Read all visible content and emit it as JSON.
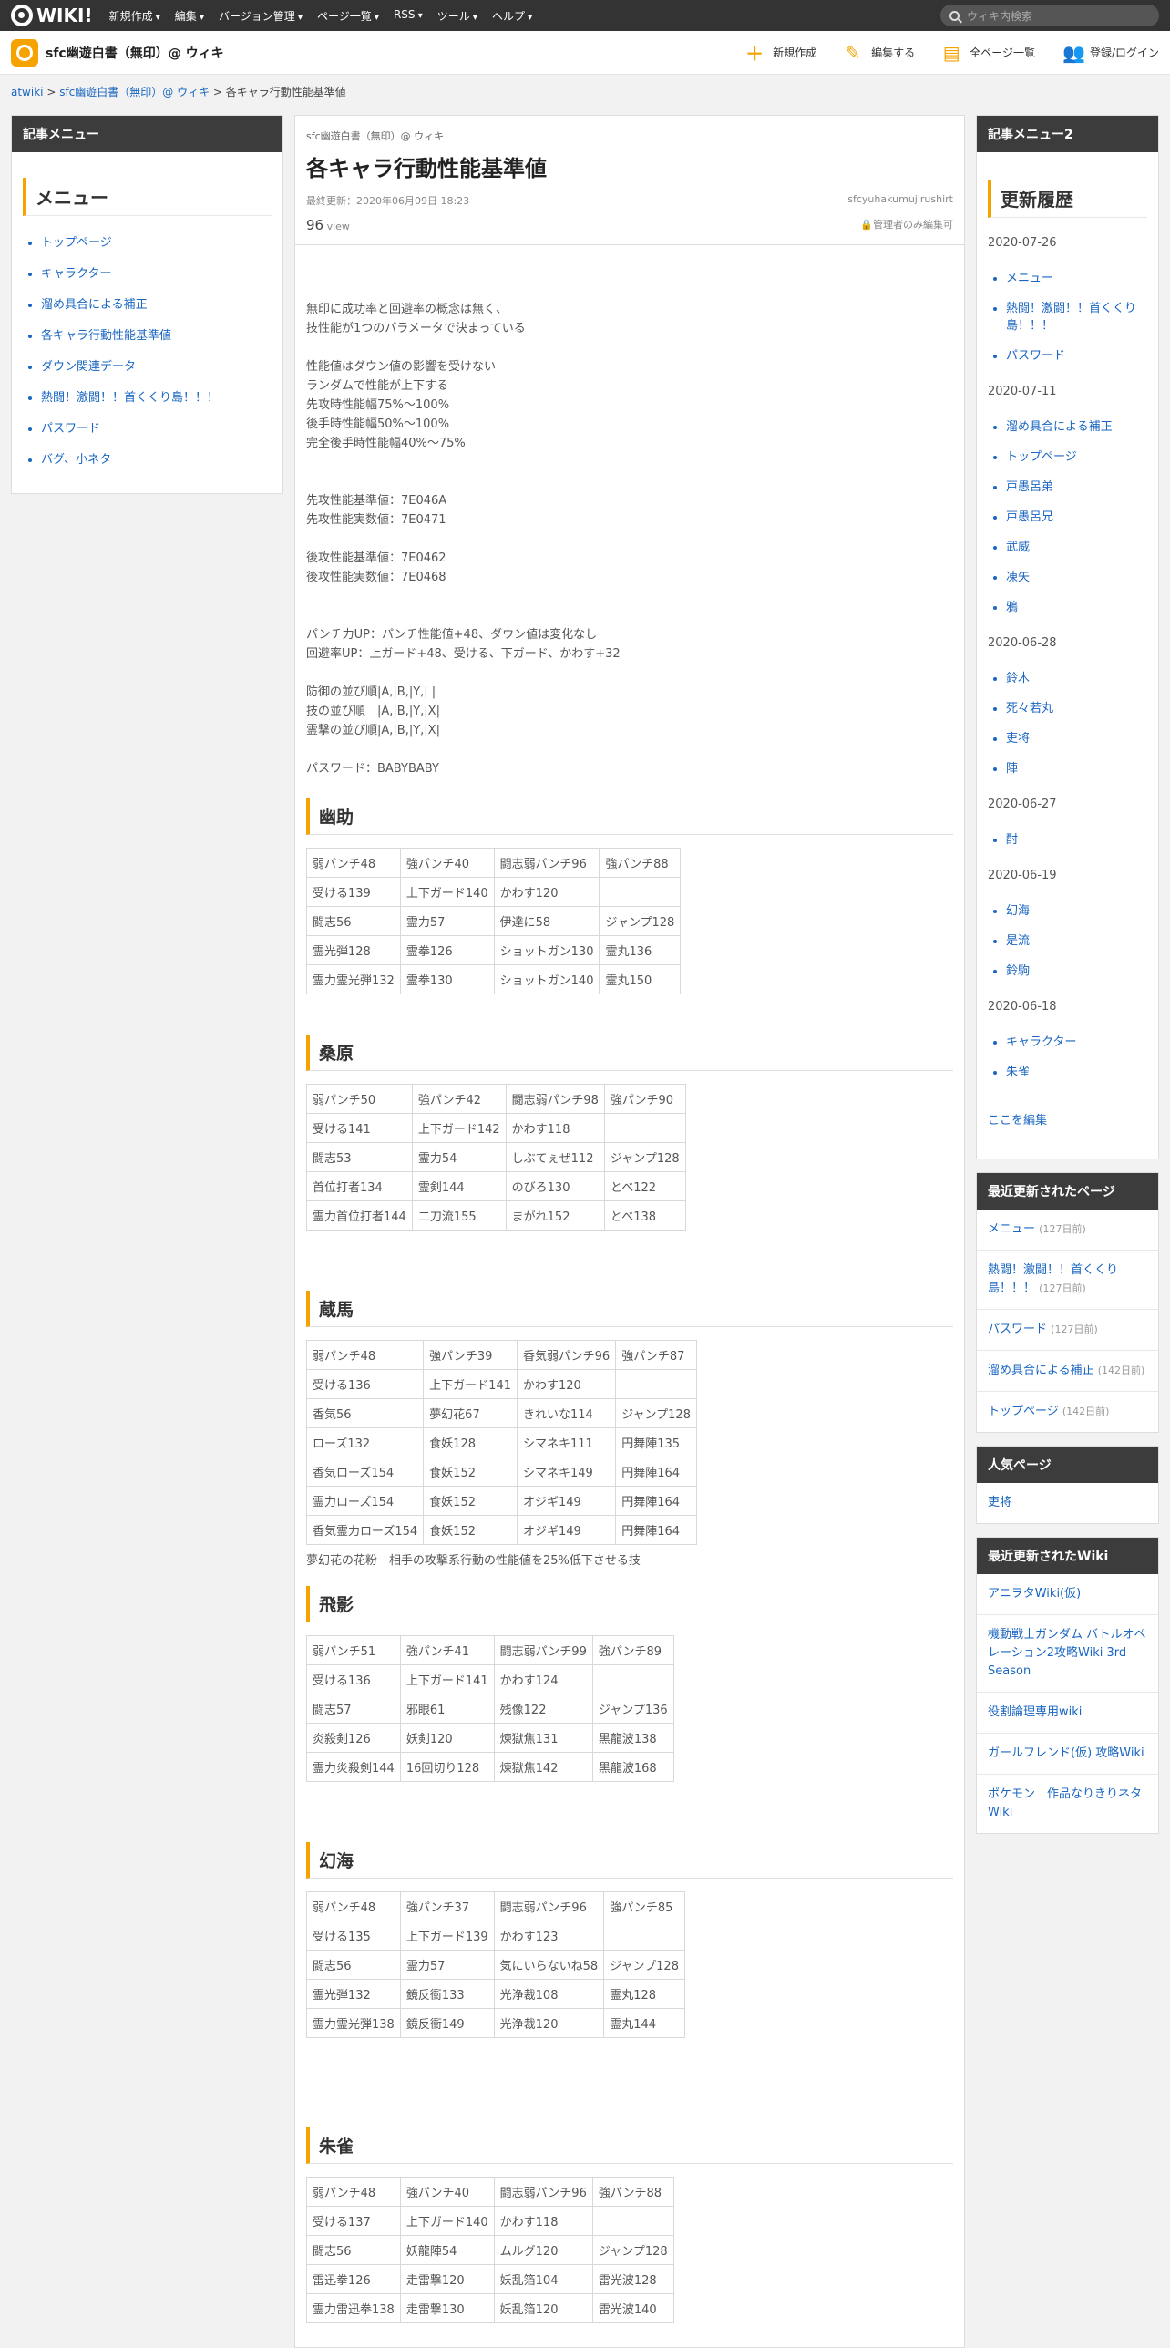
{
  "global": {
    "logo": "WIKI!",
    "menu": [
      "新規作成",
      "編集",
      "バージョン管理",
      "ページ一覧",
      "RSS",
      "ツール",
      "ヘルプ"
    ],
    "search_placeholder": "ウィキ内検索"
  },
  "header": {
    "wiki_name": "sfc幽遊白書（無印）@ ウィキ",
    "actions": [
      "新規作成",
      "編集する",
      "全ページ一覧",
      "登録/ログイン"
    ]
  },
  "breadcrumb": [
    "atwiki",
    "sfc幽遊白書（無印）@ ウィキ",
    "各キャラ行動性能基準値"
  ],
  "left": {
    "box_title": "記事メニュー",
    "menu_heading": "メニュー",
    "items": [
      "トップページ",
      "キャラクター",
      "溜め具合による補正",
      "各キャラ行動性能基準値",
      "ダウン関連データ",
      "熱闘！激闘！！首くくり島！！！",
      "パスワード",
      "バグ、小ネタ"
    ]
  },
  "article": {
    "site": "sfc幽遊白書（無印）@ ウィキ",
    "title": "各キャラ行動性能基準値",
    "updated": "最終更新：2020年06月09日 18:23",
    "author": "sfcyuhakumujirushirt",
    "views_num": "96",
    "views_label": "view",
    "lock": "管理者のみ編集可",
    "paragraphs": [
      "無印に成功率と回避率の概念は無く、\n技性能が1つのパラメータで決まっている",
      "性能値はダウン値の影響を受けない\nランダムで性能が上下する\n先攻時性能幅75%～100%\n後手時性能幅50%～100%\n完全後手時性能幅40%～75%",
      "先攻性能基準値：7E046A\n先攻性能実数値：7E0471",
      "後攻性能基準値：7E0462\n後攻性能実数値：7E0468",
      "パンチ力UP：パンチ性能値+48、ダウン値は変化なし\n回避率UP：上ガード+48、受ける、下ガード、かわす+32",
      "防御の並び順|A,|B,|Y,| |\n技の並び順　|A,|B,|Y,|X|\n霊撃の並び順|A,|B,|Y,|X|",
      "パスワード：BABYBABY"
    ],
    "sections": [
      {
        "name": "幽助",
        "rows": [
          [
            "弱パンチ48",
            "強パンチ40",
            "闘志弱パンチ96",
            "強パンチ88"
          ],
          [
            "受ける139",
            "上下ガード140",
            "かわす120",
            ""
          ],
          [
            "闘志56",
            "霊力57",
            "伊達に58",
            "ジャンプ128"
          ],
          [
            "霊光弾128",
            "霊拳126",
            "ショットガン130",
            "霊丸136"
          ],
          [
            "霊力霊光弾132",
            "霊拳130",
            "ショットガン140",
            "霊丸150"
          ]
        ],
        "note": ""
      },
      {
        "name": "桑原",
        "rows": [
          [
            "弱パンチ50",
            "強パンチ42",
            "闘志弱パンチ98",
            "強パンチ90"
          ],
          [
            "受ける141",
            "上下ガード142",
            "かわす118",
            ""
          ],
          [
            "闘志53",
            "霊力54",
            "しぶてぇぜ112",
            "ジャンプ128"
          ],
          [
            "首位打者134",
            "霊剣144",
            "のびろ130",
            "とべ122"
          ],
          [
            "霊力首位打者144",
            "二刀流155",
            "まがれ152",
            "とべ138"
          ]
        ],
        "note": ""
      },
      {
        "name": "蔵馬",
        "rows": [
          [
            "弱パンチ48",
            "強パンチ39",
            "香気弱パンチ96",
            "強パンチ87"
          ],
          [
            "受ける136",
            "上下ガード141",
            "かわす120",
            ""
          ],
          [
            "香気56",
            "夢幻花67",
            "きれいな114",
            "ジャンプ128"
          ],
          [
            "ローズ132",
            "食妖128",
            "シマネキ111",
            "円舞陣135"
          ],
          [
            "香気ローズ154",
            "食妖152",
            "シマネキ149",
            "円舞陣164"
          ],
          [
            "霊力ローズ154",
            "食妖152",
            "オジギ149",
            "円舞陣164"
          ],
          [
            "香気霊力ローズ154",
            "食妖152",
            "オジギ149",
            "円舞陣164"
          ]
        ],
        "note": "夢幻花の花粉　相手の攻撃系行動の性能値を25%低下させる技"
      },
      {
        "name": "飛影",
        "rows": [
          [
            "弱パンチ51",
            "強パンチ41",
            "闘志弱パンチ99",
            "強パンチ89"
          ],
          [
            "受ける136",
            "上下ガード141",
            "かわす124",
            ""
          ],
          [
            "闘志57",
            "邪眼61",
            "残像122",
            "ジャンプ136"
          ],
          [
            "炎殺剣126",
            "妖剣120",
            "煉獄焦131",
            "黒龍波138"
          ],
          [
            "霊力炎殺剣144",
            "16回切り128",
            "煉獄焦142",
            "黒龍波168"
          ]
        ],
        "note": ""
      },
      {
        "name": "幻海",
        "rows": [
          [
            "弱パンチ48",
            "強パンチ37",
            "闘志弱パンチ96",
            "強パンチ85"
          ],
          [
            "受ける135",
            "上下ガード139",
            "かわす123",
            ""
          ],
          [
            "闘志56",
            "霊力57",
            "気にいらないね58",
            "ジャンプ128"
          ],
          [
            "霊光弾132",
            "鏡反衝133",
            "光浄裁108",
            "霊丸128"
          ],
          [
            "霊力霊光弾138",
            "鏡反衝149",
            "光浄裁120",
            "霊丸144"
          ]
        ],
        "note": ""
      },
      {
        "name": "朱雀",
        "rows": [
          [
            "弱パンチ48",
            "強パンチ40",
            "闘志弱パンチ96",
            "強パンチ88"
          ],
          [
            "受ける137",
            "上下ガード140",
            "かわす118",
            ""
          ],
          [
            "闘志56",
            "妖龍陣54",
            "ムルグ120",
            "ジャンプ128"
          ],
          [
            "雷迅拳126",
            "走雷撃120",
            "妖乱箔104",
            "雷光波128"
          ],
          [
            "霊力雷迅拳138",
            "走雷撃130",
            "妖乱箔120",
            "雷光波140"
          ]
        ],
        "note": ""
      }
    ]
  },
  "right": {
    "box_title": "記事メニュー2",
    "heading": "更新履歴",
    "history": [
      {
        "date": "2020-07-26",
        "items": [
          "メニュー",
          "熱闘！激闘！！首くくり島！！！",
          "パスワード"
        ]
      },
      {
        "date": "2020-07-11",
        "items": [
          "溜め具合による補正",
          "トップページ",
          "戸愚呂弟",
          "戸愚呂兄",
          "武威",
          "凍矢",
          "鴉"
        ]
      },
      {
        "date": "2020-06-28",
        "items": [
          "鈴木",
          "死々若丸",
          "吏将",
          "陣"
        ]
      },
      {
        "date": "2020-06-27",
        "items": [
          "酎"
        ]
      },
      {
        "date": "2020-06-19",
        "items": [
          "幻海",
          "是流",
          "鈴駒"
        ]
      },
      {
        "date": "2020-06-18",
        "items": [
          "キャラクター",
          "朱雀"
        ]
      }
    ],
    "edit_link": "ここを編集",
    "recent_title": "最近更新されたページ",
    "recent": [
      {
        "name": "メニュー",
        "ago": "(127日前)"
      },
      {
        "name": "熱闘！激闘！！首くくり島！！！",
        "ago": "(127日前)"
      },
      {
        "name": "パスワード",
        "ago": "(127日前)"
      },
      {
        "name": "溜め具合による補正",
        "ago": "(142日前)"
      },
      {
        "name": "トップページ",
        "ago": "(142日前)"
      }
    ],
    "popular_title": "人気ページ",
    "popular": [
      "吏将"
    ],
    "wiki_title": "最近更新されたWiki",
    "wikis": [
      "アニヲタWiki(仮)",
      "機動戦士ガンダム バトルオペレーション2攻略Wiki 3rd Season",
      "役割論理専用wiki",
      "ガールフレンド(仮) 攻略Wiki",
      "ポケモン　作品なりきりネタWiki"
    ]
  }
}
